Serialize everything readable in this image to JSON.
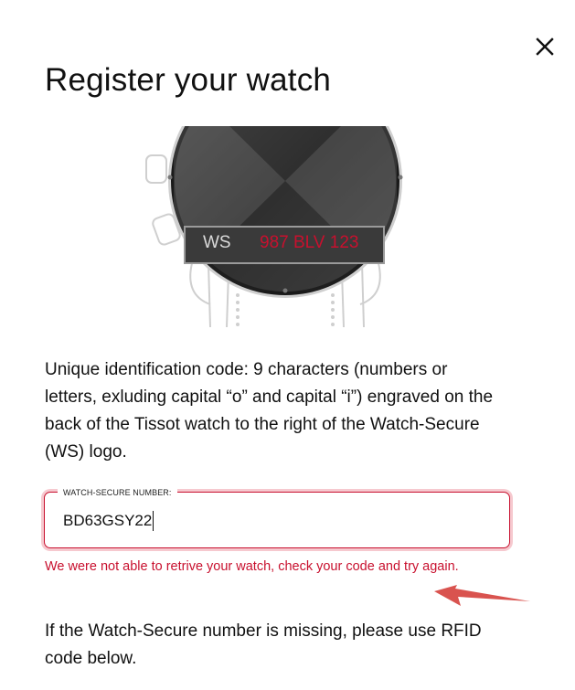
{
  "modal": {
    "title": "Register your watch",
    "close_icon": "close-icon"
  },
  "illustration": {
    "ws_label": "WS",
    "ws_code": "987 BLV 123",
    "colors": {
      "code": "#c8102e",
      "panel": "#3a3a3a"
    }
  },
  "description": "Unique identification code: 9 characters (numbers or letters, exluding capital “o” and capital “i”) engraved on the back of the Tissot watch to the right of the Watch-Secure (WS) logo.",
  "field": {
    "label": "WATCH-SECURE NUMBER:",
    "value": "BD63GSY22"
  },
  "error_message": "We were not able to retrive your watch, check your code and try again.",
  "missing_text": "If the Watch-Secure number is missing, please use RFID code below.",
  "colors": {
    "error": "#c8102e",
    "error_glow": "#f6c9cf",
    "annotation_arrow": "#d9534f"
  }
}
